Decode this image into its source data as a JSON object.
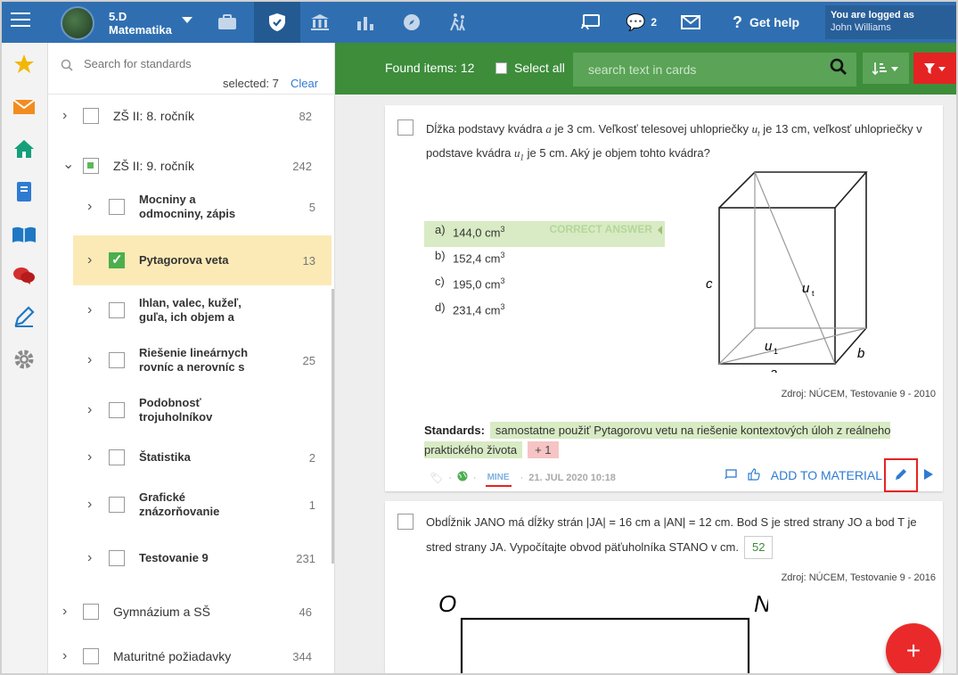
{
  "topbar": {
    "class_line1": "5.D",
    "class_line2": "Matematika",
    "messages_count": "2",
    "help_label": "Get help",
    "logged_label": "You are logged as",
    "user_name": "John Williams"
  },
  "sidebar_icons": [
    "star-icon",
    "mail-icon",
    "home-icon",
    "notebook-icon",
    "book-icon",
    "chat-icon",
    "pen-icon",
    "gear-icon"
  ],
  "standards": {
    "search_placeholder": "Search for standards",
    "selected_label": "selected: 7",
    "clear_label": "Clear",
    "tree": [
      {
        "label": "ZŠ II: 8. ročník",
        "count": "82",
        "state": "unchecked",
        "level": 0
      },
      {
        "label": "ZŠ II: 9. ročník",
        "count": "242",
        "state": "partial",
        "level": 0,
        "expanded": true
      },
      {
        "label": "Mocniny a odmocniny, zápis",
        "count": "5",
        "state": "unchecked",
        "level": 1
      },
      {
        "label": "Pytagorova veta",
        "count": "13",
        "state": "checked",
        "level": 1,
        "highlight": true
      },
      {
        "label": "Ihlan, valec, kužeľ, guľa, ich objem a",
        "count": "",
        "state": "unchecked",
        "level": 1
      },
      {
        "label": "Riešenie lineárnych rovníc a nerovníc s",
        "count": "25",
        "state": "unchecked",
        "level": 1
      },
      {
        "label": "Podobnosť trojuholníkov",
        "count": "",
        "state": "unchecked",
        "level": 1
      },
      {
        "label": "Štatistika",
        "count": "2",
        "state": "unchecked",
        "level": 1
      },
      {
        "label": "Grafické znázorňovanie",
        "count": "1",
        "state": "unchecked",
        "level": 1
      },
      {
        "label": "Testovanie 9",
        "count": "231",
        "state": "unchecked",
        "level": 1
      },
      {
        "label": "Gymnázium a SŠ",
        "count": "46",
        "state": "unchecked",
        "level": 0
      },
      {
        "label": "Maturitné požiadavky",
        "count": "344",
        "state": "unchecked",
        "level": 0
      }
    ]
  },
  "results": {
    "found_label": "Found items: 12",
    "select_all_label": "Select all",
    "search_placeholder": "search text in cards"
  },
  "card1": {
    "question_pre": "Dĺžka podstavy kvádra ",
    "question_mid1": " je 3 cm. Veľkosť telesovej uhlopriečky ",
    "question_mid2": " je 13 cm, veľkosť uhlopriečky v podstave kvádra ",
    "question_post": " je 5 cm. Aký je objem tohto kvádra?",
    "answers": [
      {
        "key": "a)",
        "value": "144,0 cm",
        "correct": true
      },
      {
        "key": "b)",
        "value": "152,4 cm",
        "correct": false
      },
      {
        "key": "c)",
        "value": "195,0 cm",
        "correct": false
      },
      {
        "key": "d)",
        "value": "231,4 cm",
        "correct": false
      }
    ],
    "correct_label": "CORRECT ANSWER",
    "source": "Zdroj: NÚCEM, Testovanie 9 - 2010",
    "standards_label": "Standards:",
    "standard_tag": "samostatne použiť Pytagorovu vetu na riešenie kontextových úloh z reálneho praktického života",
    "more_tag": "+ 1",
    "mine_label": "MINE",
    "date": "21. JUL 2020 10:18",
    "add_label": "ADD TO MATERIAL",
    "fig_labels": {
      "c": "c",
      "u_t": "u",
      "u_1": "u",
      "a": "a",
      "b": "b"
    }
  },
  "card2": {
    "question": "Obdĺžnik JANO má dĺžky strán |JA| = 16 cm a |AN| = 12 cm. Bod S je stred strany JO a bod T je stred strany JA. Vypočítajte obvod päťuholníka STANO v cm.",
    "answer": "52",
    "source": "Zdroj: NÚCEM, Testovanie 9 - 2016",
    "fig_o": "O",
    "fig_n": "N"
  },
  "fab_label": "+"
}
